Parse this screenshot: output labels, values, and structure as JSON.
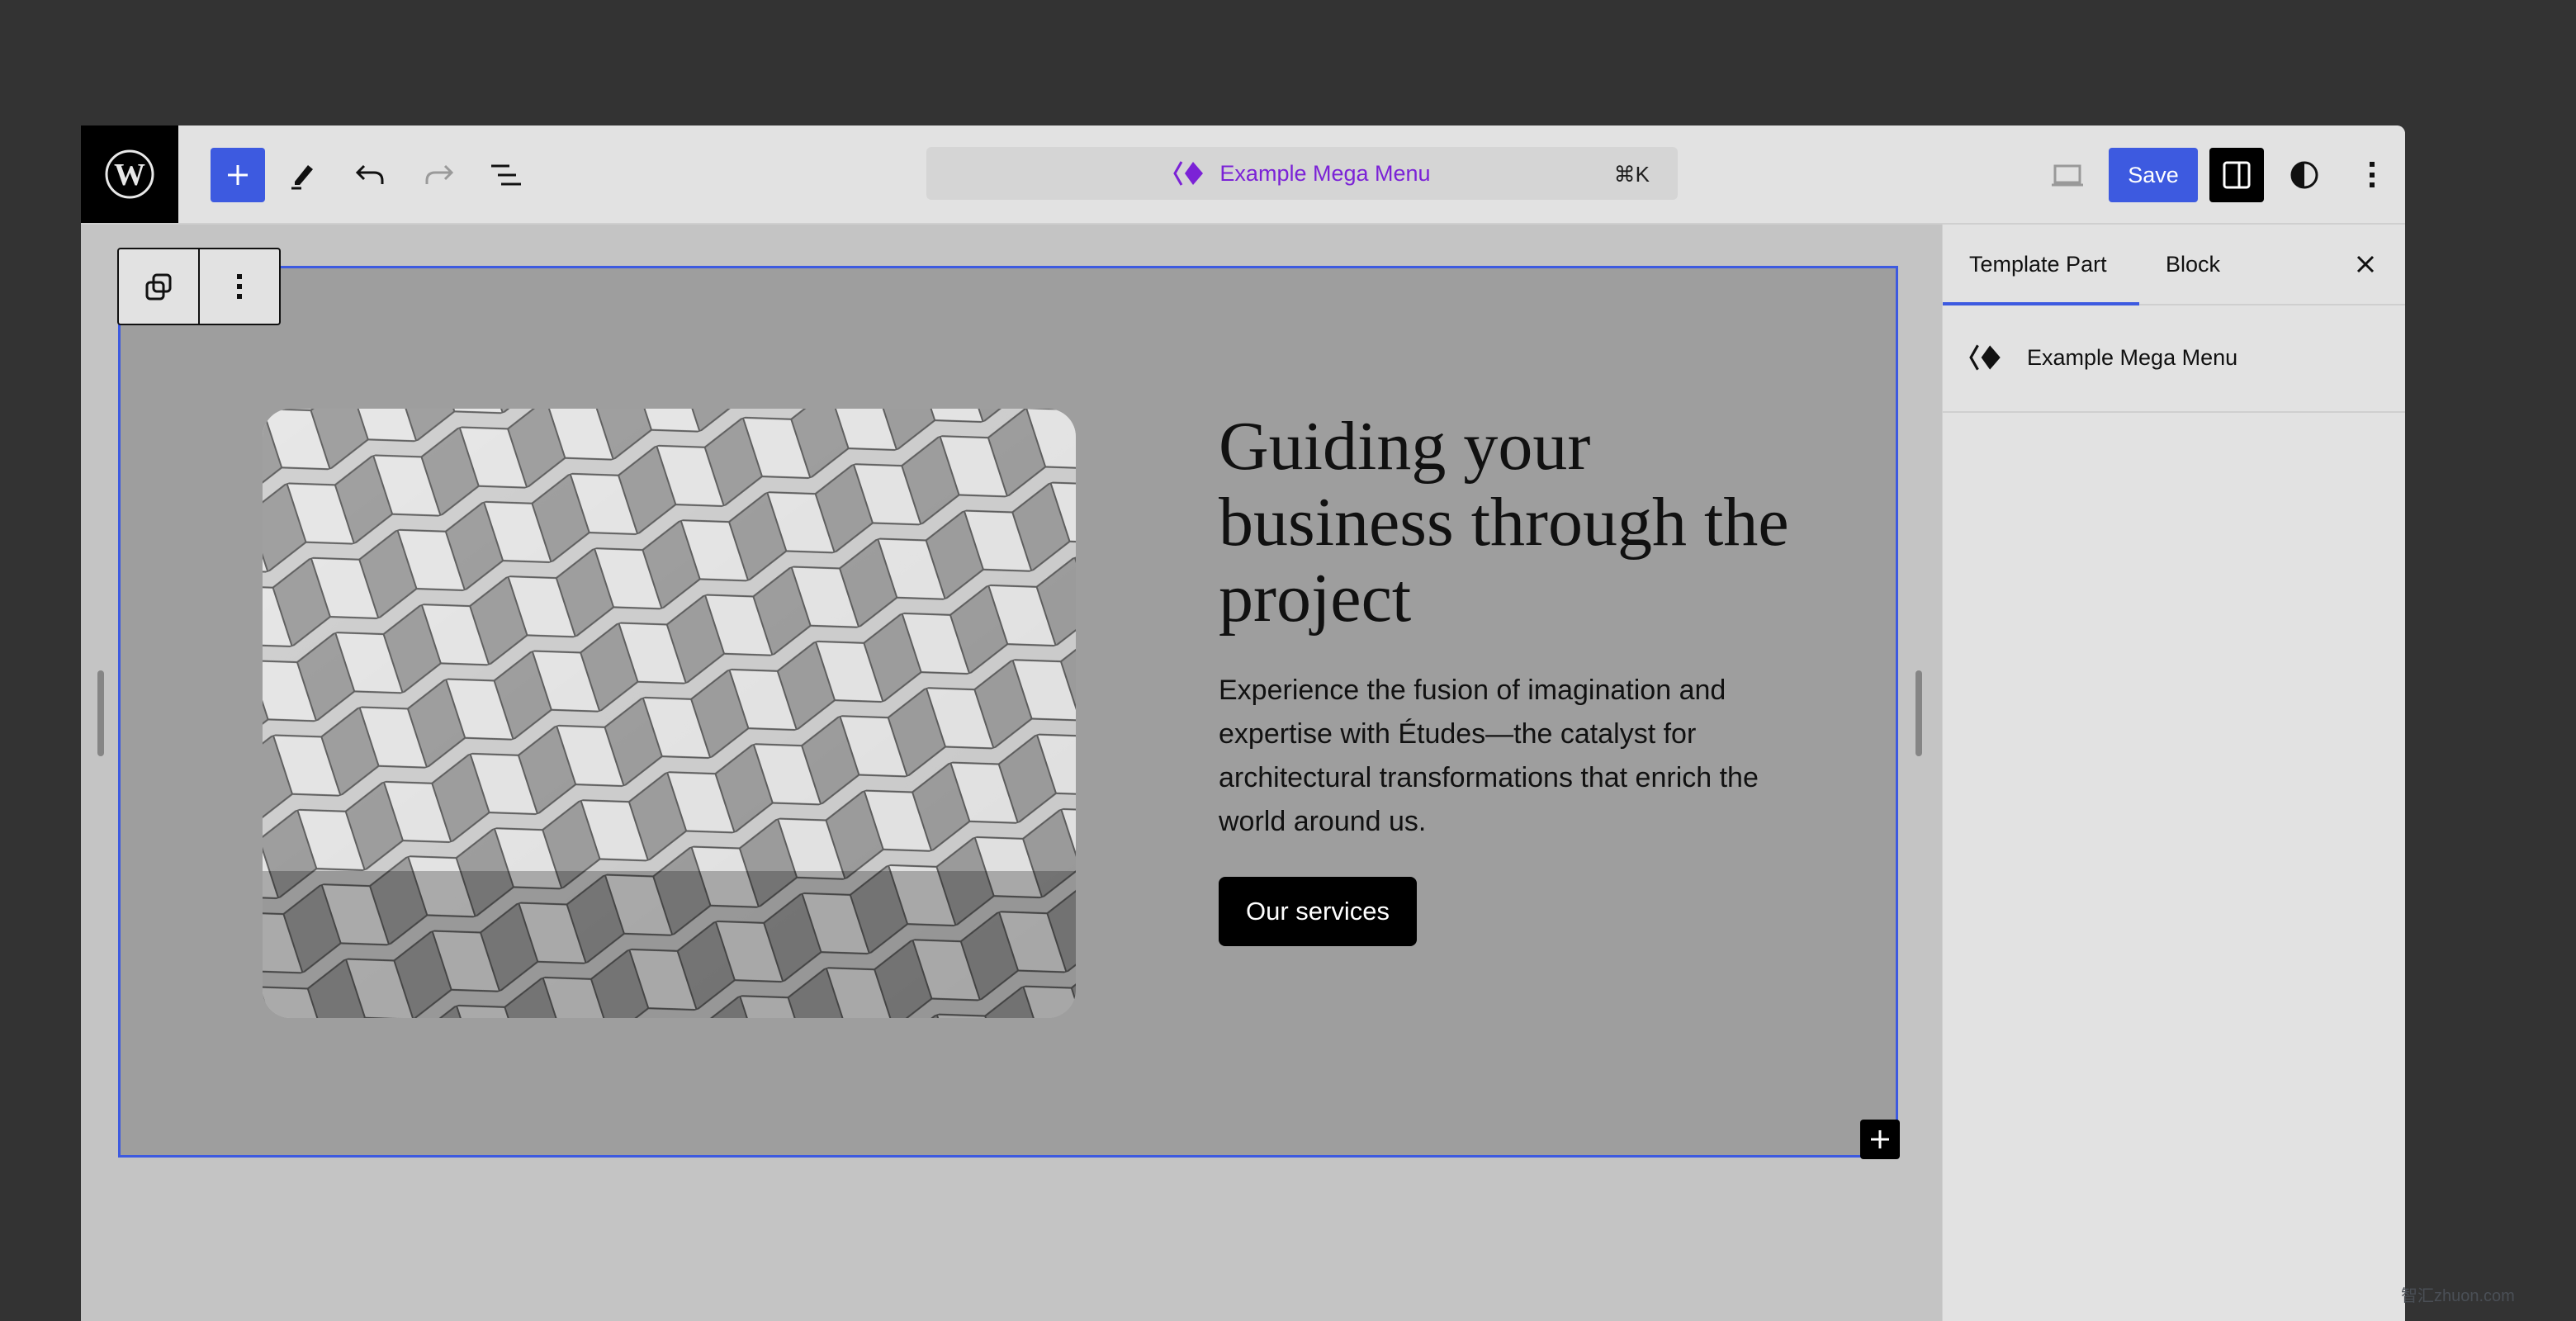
{
  "topbar": {
    "logo": "wordpress-logo",
    "icons": [
      "plus-icon",
      "pencil-icon",
      "undo-icon",
      "redo-icon",
      "list-view-icon"
    ],
    "command_center": {
      "title": "Example Mega Menu",
      "shortcut": "⌘K",
      "icon": "template-part-icon"
    },
    "save_label": "Save",
    "right_icons": [
      "desktop-preview-icon",
      "sidebar-toggle-icon",
      "styles-icon",
      "options-icon"
    ],
    "accent_color": "#3d5ae0",
    "title_color": "#7b22d6"
  },
  "block_toolbar": {
    "icons": [
      "template-part-switch-icon",
      "more-options-icon"
    ]
  },
  "content": {
    "heading": "Guiding your business through the project",
    "paragraph": "Experience the fusion of imagination and expertise with Études—the catalyst for architectural transformations that enrich the world around us.",
    "button_label": "Our services",
    "image_alt": "architectural facade pattern"
  },
  "sidebar": {
    "tabs": [
      {
        "label": "Template Part",
        "active": true
      },
      {
        "label": "Block",
        "active": false
      }
    ],
    "item_title": "Example Mega Menu"
  },
  "watermark": "智汇zhuon.com"
}
